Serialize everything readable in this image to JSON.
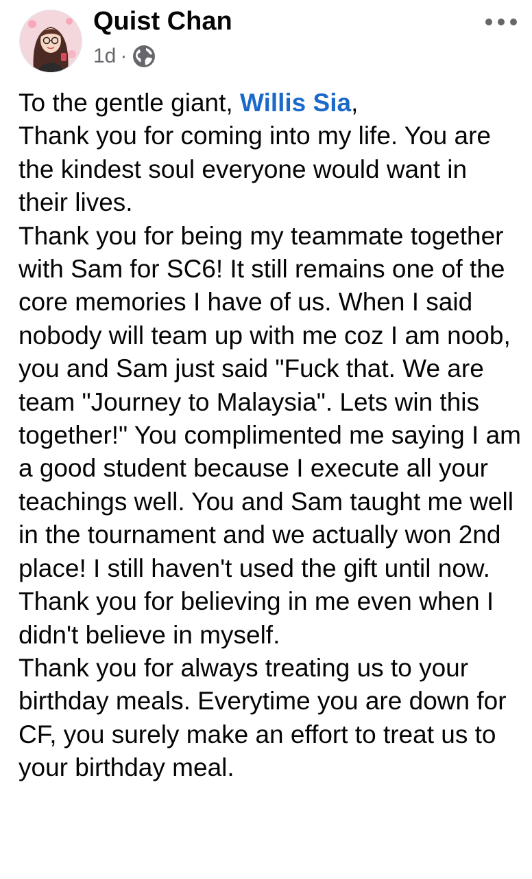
{
  "post": {
    "author": "Quist Chan",
    "time": "1d",
    "meta_separator": "·",
    "privacy_icon": "globe-icon",
    "more_icon": "more-options-icon",
    "mention_color": "#1b6ac9"
  },
  "body": {
    "greeting_prefix": "To the gentle giant, ",
    "mention_name": "Willis Sia",
    "greeting_suffix": ",",
    "paragraph_1": "Thank you for coming into my life. You are the kindest soul everyone would want in their lives.",
    "paragraph_2": "Thank you for being my teammate together with Sam for SC6! It still remains one of the core memories I have of us. When I said nobody will team up with me coz I am noob, you and Sam just said \"Fuck that. We are team \"Journey to Malaysia\". Lets win this together!\" You complimented me saying I am a good student because I execute all your teachings well. You and Sam taught me well in the tournament and we actually won 2nd place! I still haven't used the gift until now.",
    "paragraph_3": "Thank you for believing in me even when I didn't believe in myself.",
    "paragraph_4": "Thank you for always treating us to your birthday meals. Everytime you are down for CF, you surely make an effort to treat us to your birthday meal."
  }
}
